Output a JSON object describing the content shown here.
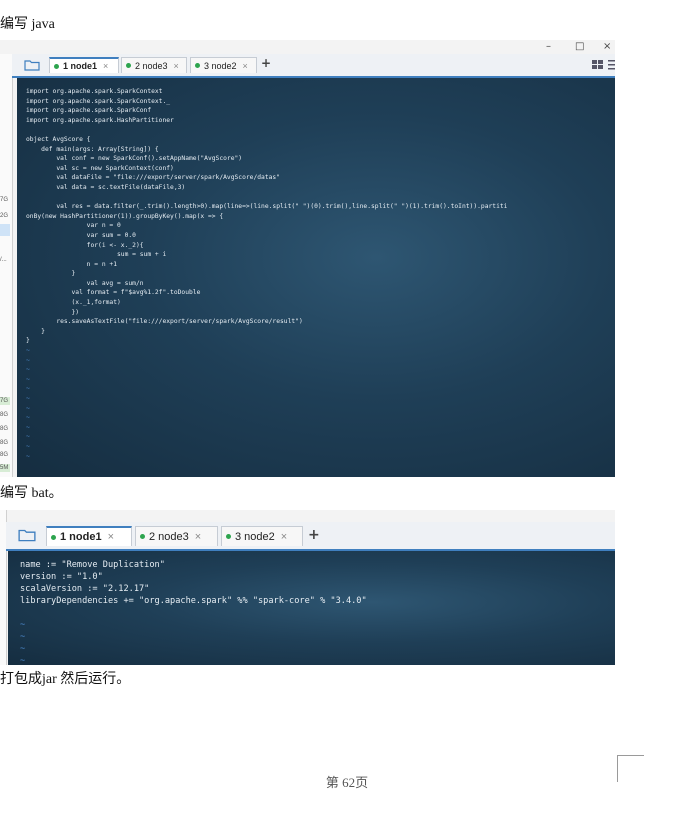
{
  "doc": {
    "para1": "编写 java",
    "para2": "编写 bat。",
    "para3": "打包成jar 然后运行。",
    "footer": "第 62页"
  },
  "window1": {
    "controls": {
      "minimize": "–",
      "maximize": "□",
      "close": "×"
    },
    "tabs": [
      {
        "label": "1 node1",
        "active": true
      },
      {
        "label": "2 node3",
        "active": false
      },
      {
        "label": "3 node2",
        "active": false
      }
    ],
    "tab_close": "×",
    "add_tab": "+",
    "code": [
      "import org.apache.spark.SparkContext",
      "import org.apache.spark.SparkContext._",
      "import org.apache.spark.SparkConf",
      "import org.apache.spark.HashPartitioner",
      "",
      "object AvgScore {",
      "    def main(args: Array[String]) {",
      "        val conf = new SparkConf().setAppName(\"AvgScore\")",
      "        val sc = new SparkContext(conf)",
      "        val dataFile = \"file:///export/server/spark/AvgScore/datas\"",
      "        val data = sc.textFile(dataFile,3)",
      "",
      "        val res = data.filter(_.trim().length>0).map(line=>(line.split(\" \")(0).trim(),line.split(\" \")(1).trim().toInt)).partiti",
      "onBy(new HashPartitioner(1)).groupByKey().map(x => {",
      "                var n = 0",
      "                var sum = 0.0",
      "                for(i <- x._2){",
      "                        sum = sum + i",
      "                n = n +1",
      "            }",
      "                val avg = sum/n",
      "            val format = f\"$avg%1.2f\".toDouble",
      "            (x._1,format)",
      "            })",
      "        res.saveAsTextFile(\"file:///export/server/spark/AvgScore/result\")",
      "    }",
      "}"
    ],
    "tildes": [
      "~",
      "~",
      "~",
      "~",
      "~",
      "~",
      "~",
      "~",
      "~",
      "~",
      "~",
      "~"
    ],
    "left_strip": [
      "7G",
      "2G",
      "/...",
      "7G",
      "8G",
      "8G",
      "8G",
      "8G",
      "5M",
      "7M"
    ]
  },
  "window2": {
    "tabs": [
      {
        "label": "1 node1",
        "active": true
      },
      {
        "label": "2 node3",
        "active": false
      },
      {
        "label": "3 node2",
        "active": false
      }
    ],
    "tab_close": "×",
    "add_tab": "+",
    "code": [
      "name := \"Remove Duplication\"",
      "version := \"1.0\"",
      "scalaVersion := \"2.12.17\"",
      "libraryDependencies += \"org.apache.spark\" %% \"spark-core\" % \"3.4.0\""
    ],
    "tildes": [
      "~",
      "~",
      "~",
      "~"
    ]
  },
  "colors": {
    "accent": "#3f7fbf",
    "terminal_bg": "#1f3f57",
    "tab_dot": "#2da44e",
    "tilde": "#4a86c8"
  }
}
